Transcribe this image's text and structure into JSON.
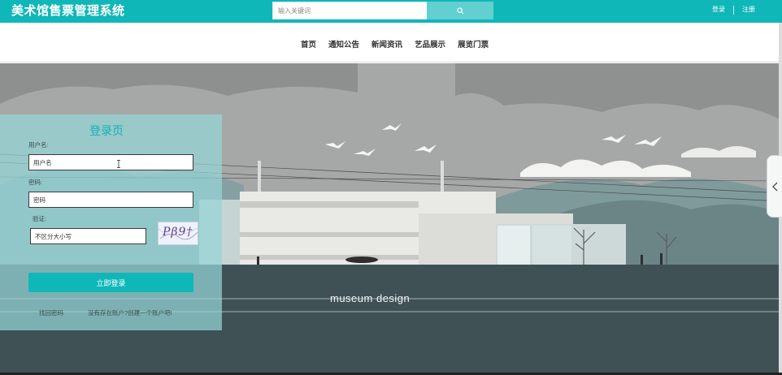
{
  "header": {
    "site_title": "美术馆售票管理系统",
    "search_placeholder": "输入关键词",
    "login": "登录",
    "register": "注册"
  },
  "nav": {
    "items": [
      "首页",
      "通知公告",
      "新闻资讯",
      "艺品展示",
      "展览门票"
    ]
  },
  "hero": {
    "slogan": "museum design"
  },
  "login_form": {
    "title": "登录页",
    "username_label": "用户名:",
    "username_placeholder": "用户名",
    "password_label": "密码:",
    "password_placeholder": "密码",
    "captcha_label": "验证:",
    "captcha_placeholder": "不区分大小写",
    "captcha_image_text": "Pβ9†",
    "submit": "立即登录",
    "forgot_password": "找回密码",
    "register_link": "没有存在账户?创建一个账户吧!"
  },
  "colors": {
    "accent": "#10b7b8",
    "search_button": "#62cfd0",
    "sky": "#a7a9a8",
    "ground": "#3f5155"
  }
}
